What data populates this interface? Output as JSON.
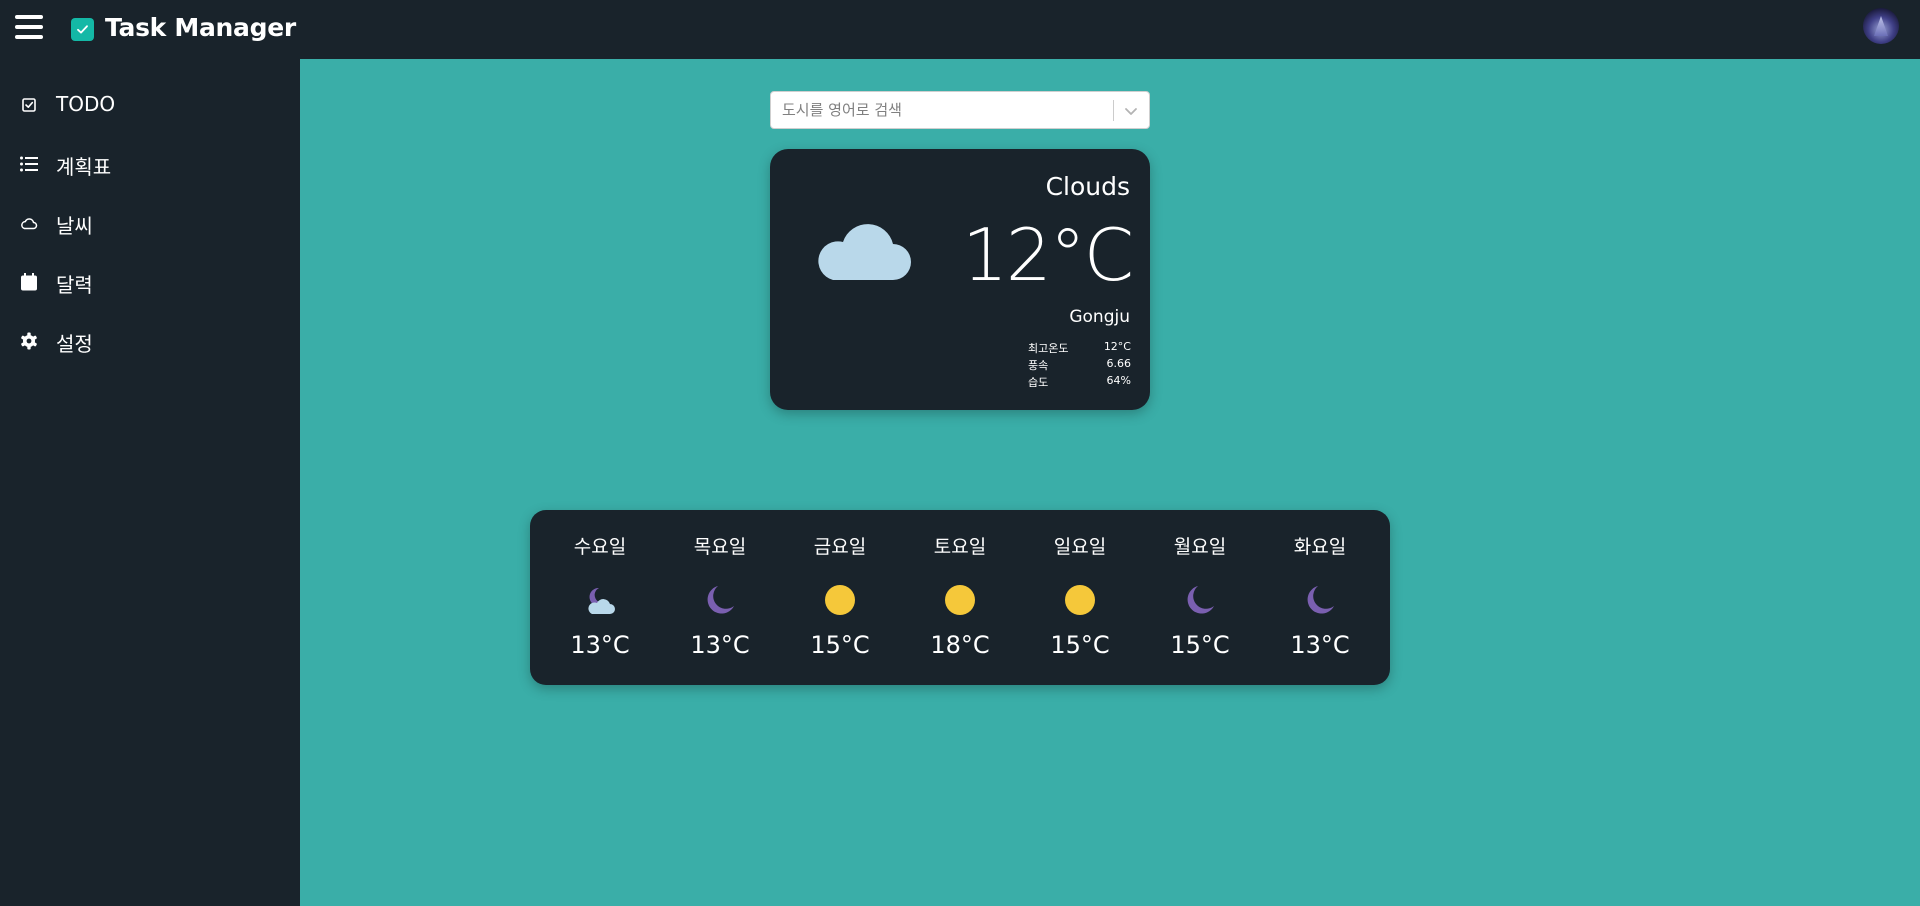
{
  "header": {
    "app_title": "Task Manager",
    "menu_icon": "hamburger-icon",
    "logo_icon": "check-badge-icon",
    "accent_color": "#14b8a6",
    "bar_color": "#19232b"
  },
  "sidebar": {
    "items": [
      {
        "label": "TODO",
        "icon": "checkbox-icon"
      },
      {
        "label": "계획표",
        "icon": "list-icon"
      },
      {
        "label": "날씨",
        "icon": "cloud-icon"
      },
      {
        "label": "달력",
        "icon": "calendar-icon"
      },
      {
        "label": "설정",
        "icon": "gear-icon"
      }
    ]
  },
  "search": {
    "placeholder": "도시를 영어로 검색",
    "value": ""
  },
  "current_weather": {
    "condition": "Clouds",
    "temperature": "12°C",
    "city": "Gongju",
    "icon": "cloud-icon",
    "stats": [
      {
        "label": "최고온도",
        "value": "12°C"
      },
      {
        "label": "풍속",
        "value": "6.66"
      },
      {
        "label": "습도",
        "value": "64%"
      }
    ]
  },
  "forecast": {
    "days": [
      {
        "day": "수요일",
        "temp": "13°C",
        "icon": "moon-cloud-icon"
      },
      {
        "day": "목요일",
        "temp": "13°C",
        "icon": "moon-icon"
      },
      {
        "day": "금요일",
        "temp": "15°C",
        "icon": "sun-icon"
      },
      {
        "day": "토요일",
        "temp": "18°C",
        "icon": "sun-icon"
      },
      {
        "day": "일요일",
        "temp": "15°C",
        "icon": "sun-icon"
      },
      {
        "day": "월요일",
        "temp": "15°C",
        "icon": "moon-icon"
      },
      {
        "day": "화요일",
        "temp": "13°C",
        "icon": "moon-icon"
      }
    ]
  },
  "colors": {
    "background": "#3aaea8",
    "panel": "#19232b",
    "sun": "#f5c83a",
    "moon": "#7a5fb0",
    "cloud": "#b9d8ea"
  }
}
